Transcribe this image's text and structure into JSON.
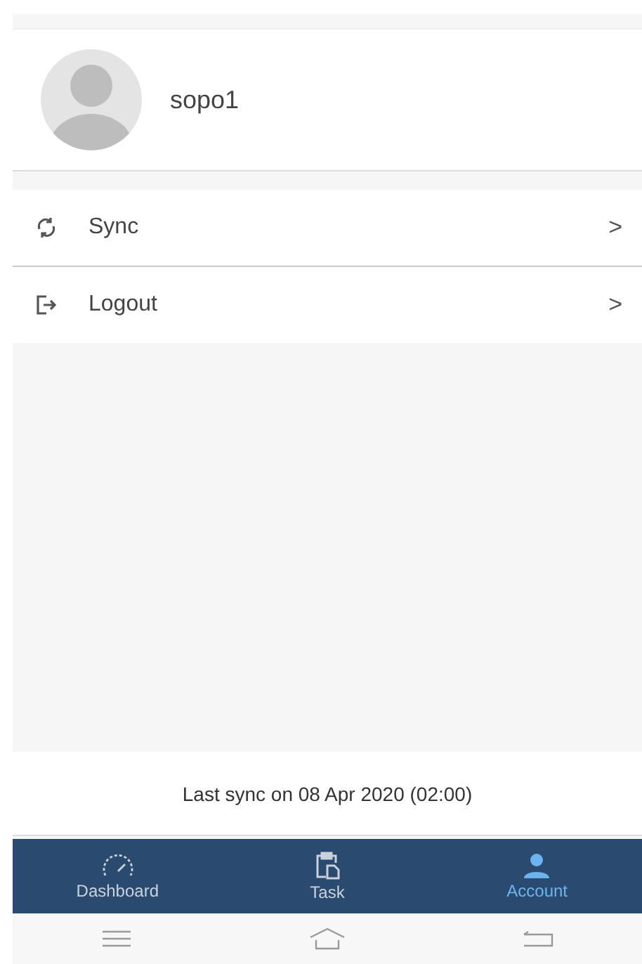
{
  "profile": {
    "username": "sopo1"
  },
  "menu": [
    {
      "kind": "sync",
      "label": "Sync",
      "chevron": ">"
    },
    {
      "kind": "logout",
      "label": "Logout",
      "chevron": ">"
    }
  ],
  "footer": {
    "last_sync": "Last sync on 08 Apr 2020 (02:00)"
  },
  "bottom_nav": [
    {
      "kind": "dashboard",
      "label": "Dashboard",
      "selected": false
    },
    {
      "kind": "task",
      "label": "Task",
      "selected": false
    },
    {
      "kind": "account",
      "label": "Account",
      "selected": true
    }
  ],
  "system_nav": [
    {
      "kind": "recents"
    },
    {
      "kind": "home"
    },
    {
      "kind": "back"
    }
  ]
}
